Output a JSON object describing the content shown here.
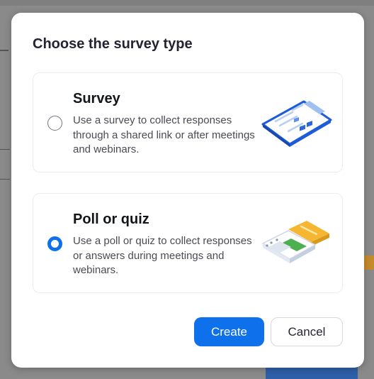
{
  "dialog": {
    "title": "Choose the survey type",
    "options": [
      {
        "title": "Survey",
        "description": "Use a survey to collect responses through a shared link or after meetings and webinars.",
        "selected": false,
        "icon": "survey-form-illustration"
      },
      {
        "title": "Poll or quiz",
        "description": "Use a poll or quiz to collect responses or answers during meetings and webinars.",
        "selected": true,
        "icon": "poll-quiz-illustration"
      }
    ],
    "buttons": {
      "create": "Create",
      "cancel": "Cancel"
    }
  },
  "colors": {
    "accent": "#0e71eb",
    "overlay": "#8a8a8a",
    "poll_yellow": "#f5b731",
    "poll_green": "#4cb050"
  }
}
